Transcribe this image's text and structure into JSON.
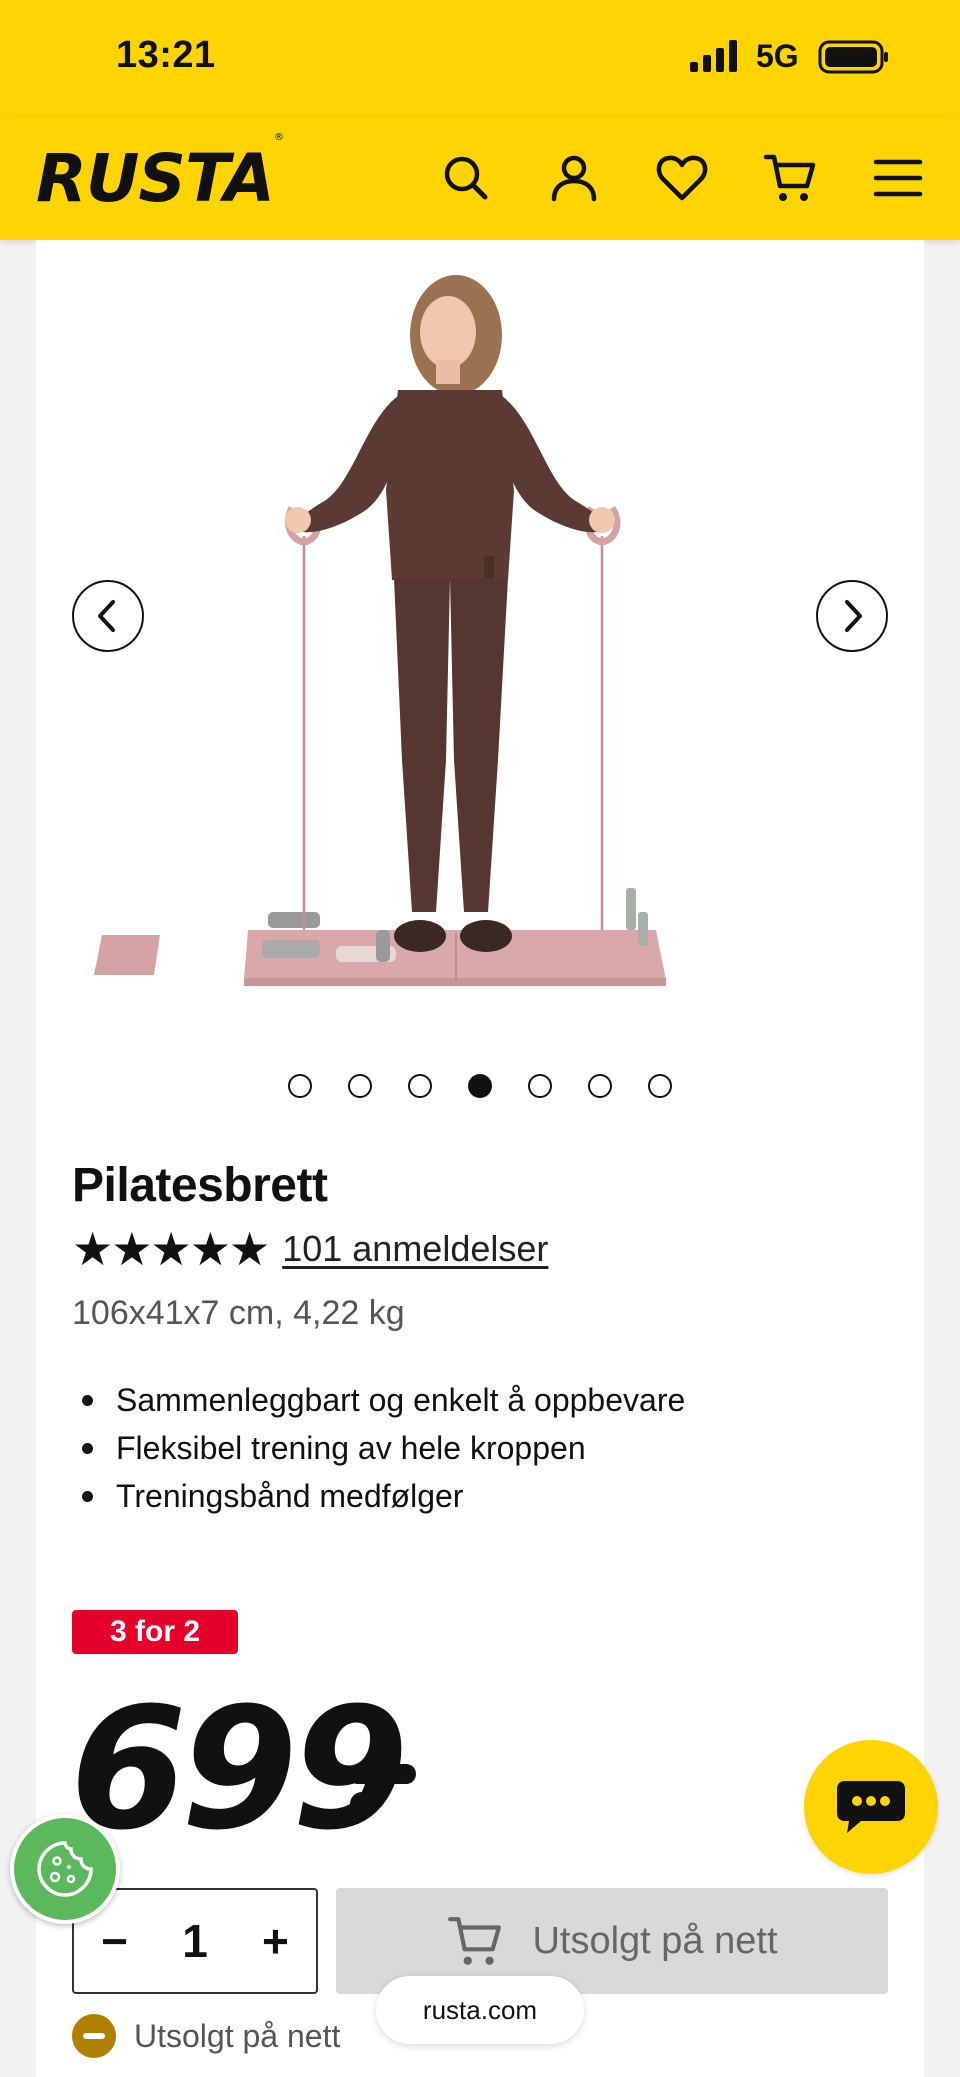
{
  "status_bar": {
    "time": "13:21",
    "network": "5G"
  },
  "header": {
    "logo": "RUSTA",
    "icons": [
      "search-icon",
      "account-icon",
      "heart-icon",
      "cart-icon",
      "menu-icon"
    ]
  },
  "gallery": {
    "image_count": 7,
    "active_index": 3,
    "prev_icon": "chevron-left-icon",
    "next_icon": "chevron-right-icon"
  },
  "product": {
    "title": "Pilatesbrett",
    "rating": 4.5,
    "stars": "★★★★★",
    "reviews": "101 anmeldelser",
    "dimensions": "106x41x7 cm, 4,22 kg",
    "features": [
      "Sammenleggbart og enkelt å oppbevare",
      "Fleksibel trening av hele kroppen",
      "Treningsbånd medfølger"
    ],
    "promo_badge": "3 for 2",
    "price": "699",
    "quantity": "1",
    "qty_minus": "−",
    "qty_plus": "+",
    "buy_button": "Utsolgt på nett",
    "availability": "Utsolgt på nett"
  },
  "browser": {
    "url": "rusta.com"
  },
  "colors": {
    "brand_yellow": "#ffd400",
    "promo_red": "#e4002b",
    "cookie_green": "#5cb85c",
    "soldout_icon": "#b08100"
  }
}
